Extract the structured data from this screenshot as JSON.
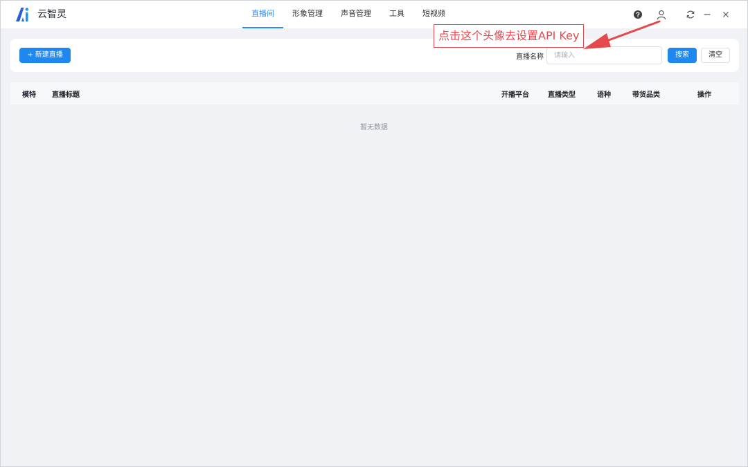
{
  "app": {
    "name": "云智灵",
    "brand_color": "#2d8cf0"
  },
  "nav": {
    "tabs": [
      {
        "label": "直播间",
        "active": true
      },
      {
        "label": "形象管理",
        "active": false
      },
      {
        "label": "声音管理",
        "active": false
      },
      {
        "label": "工具",
        "active": false
      },
      {
        "label": "短视频",
        "active": false
      }
    ]
  },
  "window_icons": [
    "help-icon",
    "user-icon",
    "refresh-icon",
    "minimize-icon",
    "close-icon"
  ],
  "toolbar": {
    "new_live_label": "+ 新建直播",
    "search_label": "直播名称",
    "search_placeholder": "请输入",
    "search_value": "",
    "search_button": "搜索",
    "clear_button": "清空"
  },
  "table": {
    "columns": [
      "模特",
      "直播标题",
      "开播平台",
      "直播类型",
      "语种",
      "带货品类",
      "操作"
    ],
    "rows": [],
    "empty_text": "暂无数据"
  },
  "annotation": {
    "text": "点击这个头像去设置API Key",
    "color": "#e5484d"
  }
}
